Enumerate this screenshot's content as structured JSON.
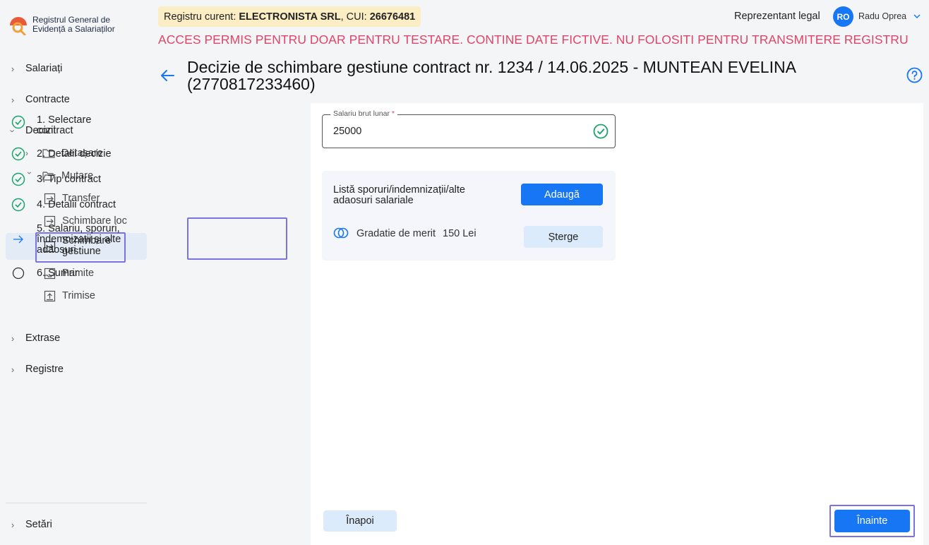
{
  "app": {
    "logo_line1": "Registrul General de",
    "logo_line2": "Evidență a Salariaților"
  },
  "sidebar": {
    "items": [
      {
        "label": "Salariați"
      },
      {
        "label": "Contracte"
      },
      {
        "label": "Decizii"
      },
      {
        "label": "Extrase"
      },
      {
        "label": "Registre"
      },
      {
        "label": "Setări"
      }
    ],
    "decizii_sub": [
      {
        "label": "Detașare"
      },
      {
        "label": "Mutare"
      }
    ],
    "mutare_sub": [
      {
        "label": "Transfer"
      },
      {
        "label": "Schimbare loc"
      },
      {
        "label": "Schimbare gestiune"
      }
    ],
    "other_sub": [
      {
        "label": "Primite"
      },
      {
        "label": "Trimise"
      }
    ]
  },
  "header": {
    "registry_prefix": "Registru curent: ",
    "company": "ELECTRONISTA SRL",
    "cui_prefix": ", CUI: ",
    "cui": "26676481",
    "role": "Reprezentant legal",
    "avatar_initials": "RO",
    "user_name": "Radu Oprea",
    "warning": "ACCES PERMIS PENTRU DOAR PENTRU TESTARE. CONTINE DATE FICTIVE. NU FOLOSITI PENTRU TRANSMITERE REGISTRU"
  },
  "page": {
    "title": "Decizie de schimbare gestiune contract nr. 1234 / 14.06.2025 - MUNTEAN EVELINA (2770817233460)"
  },
  "steps": [
    {
      "label": "1. Selectare contract",
      "state": "done"
    },
    {
      "label": "2. Detalii decizie",
      "state": "done"
    },
    {
      "label": "3. Tip contract",
      "state": "done"
    },
    {
      "label": "4. Detalii contract",
      "state": "done"
    },
    {
      "label": "5. Salariu, sporuri, îndemnizații și alte adaosuri",
      "state": "active"
    },
    {
      "label": "6. Sumar",
      "state": "pending"
    }
  ],
  "form": {
    "salary_label": "Salariu brut lunar",
    "salary_required": "*",
    "salary_value": "25000",
    "sporuri_title": "Listă sporuri/indemnizații/alte adaosuri salariale",
    "add_button": "Adaugă",
    "sporuri": [
      {
        "name": "Gradatie de merit",
        "value": "150 Lei",
        "delete_label": "Șterge"
      }
    ],
    "back_button": "Înapoi",
    "next_button": "Înainte"
  },
  "colors": {
    "accent": "#1676f3",
    "warning": "#e0446a",
    "success": "#1aa36a",
    "highlight": "#7b72e6"
  }
}
